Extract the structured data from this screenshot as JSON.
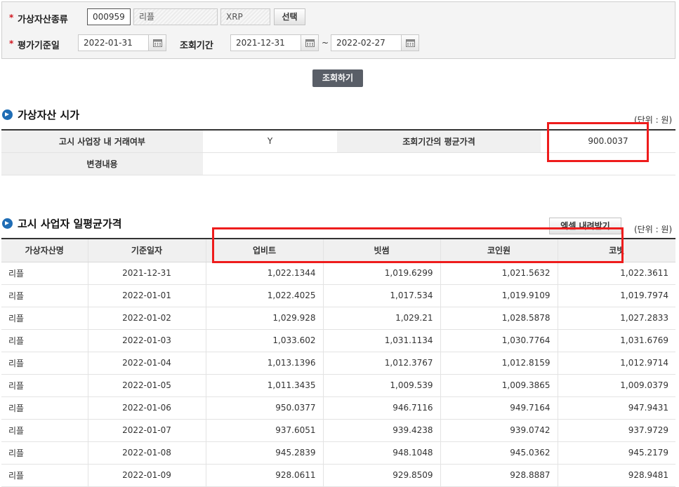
{
  "search": {
    "asset_type_label": "가상자산종류",
    "asset_code": "000959",
    "asset_name": "리플",
    "asset_symbol": "XRP",
    "select_button": "선택",
    "eval_date_label": "평가기준일",
    "eval_date": "2022-01-31",
    "period_label": "조회기간",
    "period_start": "2021-12-31",
    "period_sep": "~",
    "period_end": "2022-02-27",
    "search_button": "조회하기"
  },
  "section1": {
    "title": "가상자산 시가",
    "unit": "(단위 : 원)",
    "trade_label": "고시 사업장 내 거래여부",
    "trade_value": "Y",
    "avg_label": "조회기간의 평균가격",
    "avg_value": "900.0037",
    "change_label": "변경내용",
    "change_value": ""
  },
  "section2": {
    "title": "고시 사업자 일평균가격",
    "excel_button": "엑셀 내려받기",
    "unit": "(단위 : 원)",
    "columns": [
      "가상자산명",
      "기준일자",
      "업비트",
      "빗썸",
      "코인원",
      "코빗"
    ],
    "rows": [
      [
        "리플",
        "2021-12-31",
        "1,022.1344",
        "1,019.6299",
        "1,021.5632",
        "1,022.3611"
      ],
      [
        "리플",
        "2022-01-01",
        "1,022.4025",
        "1,017.534",
        "1,019.9109",
        "1,019.7974"
      ],
      [
        "리플",
        "2022-01-02",
        "1,029.928",
        "1,029.21",
        "1,028.5878",
        "1,027.2833"
      ],
      [
        "리플",
        "2022-01-03",
        "1,033.602",
        "1,031.1134",
        "1,030.7764",
        "1,031.6769"
      ],
      [
        "리플",
        "2022-01-04",
        "1,013.1396",
        "1,012.3767",
        "1,012.8159",
        "1,012.9714"
      ],
      [
        "리플",
        "2022-01-05",
        "1,011.3435",
        "1,009.539",
        "1,009.3865",
        "1,009.0379"
      ],
      [
        "리플",
        "2022-01-06",
        "950.0377",
        "946.7116",
        "949.7164",
        "947.9431"
      ],
      [
        "리플",
        "2022-01-07",
        "937.6051",
        "939.4238",
        "939.0742",
        "937.9729"
      ],
      [
        "리플",
        "2022-01-08",
        "945.2839",
        "948.1048",
        "945.0362",
        "945.2179"
      ],
      [
        "리플",
        "2022-01-09",
        "928.0611",
        "929.8509",
        "928.8887",
        "928.9481"
      ]
    ]
  },
  "colors": {
    "highlight": "#ee1c1c",
    "required_star": "#d0141d",
    "section_icon": "#1f6db5",
    "primary_button": "#595e67"
  },
  "icons": {
    "calendar": "calendar-icon",
    "section": "arrow-circle-icon"
  },
  "required_mark": "*"
}
